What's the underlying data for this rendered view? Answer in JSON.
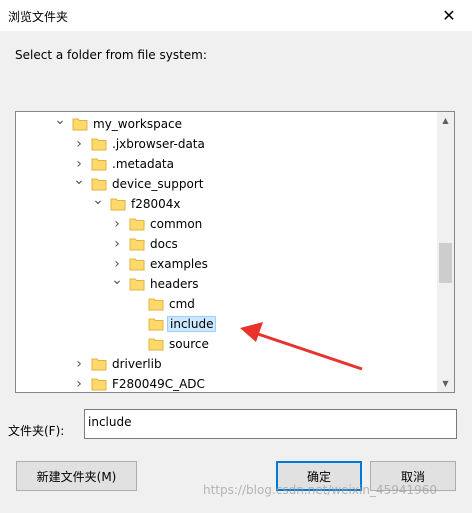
{
  "window": {
    "title": "浏览文件夹",
    "close_glyph": "✕"
  },
  "prompt": "Select a folder from file system:",
  "tree": {
    "items": [
      {
        "label": "my_workspace",
        "indent": 0,
        "state": "expanded"
      },
      {
        "label": ".jxbrowser-data",
        "indent": 1,
        "state": "collapsed"
      },
      {
        "label": ".metadata",
        "indent": 1,
        "state": "collapsed"
      },
      {
        "label": "device_support",
        "indent": 1,
        "state": "expanded"
      },
      {
        "label": "f28004x",
        "indent": 2,
        "state": "expanded"
      },
      {
        "label": "common",
        "indent": 3,
        "state": "collapsed"
      },
      {
        "label": "docs",
        "indent": 3,
        "state": "collapsed"
      },
      {
        "label": "examples",
        "indent": 3,
        "state": "collapsed"
      },
      {
        "label": "headers",
        "indent": 3,
        "state": "expanded"
      },
      {
        "label": "cmd",
        "indent": 4,
        "state": "none"
      },
      {
        "label": "include",
        "indent": 4,
        "state": "none",
        "selected": true
      },
      {
        "label": "source",
        "indent": 4,
        "state": "none"
      },
      {
        "label": "driverlib",
        "indent": 1,
        "state": "collapsed"
      },
      {
        "label": "F280049C_ADC",
        "indent": 1,
        "state": "collapsed"
      }
    ]
  },
  "folder_field": {
    "label": "文件夹(F):",
    "value": "include"
  },
  "buttons": {
    "new_folder": "新建文件夹(M)",
    "ok": "确定",
    "cancel": "取消"
  },
  "watermark": "https://blog.csdn.net/weixin_45941960",
  "colors": {
    "selection": "#cce8ff",
    "accent": "#0078d7",
    "arrow": "#e8322c",
    "folder": "#ffd96b"
  }
}
